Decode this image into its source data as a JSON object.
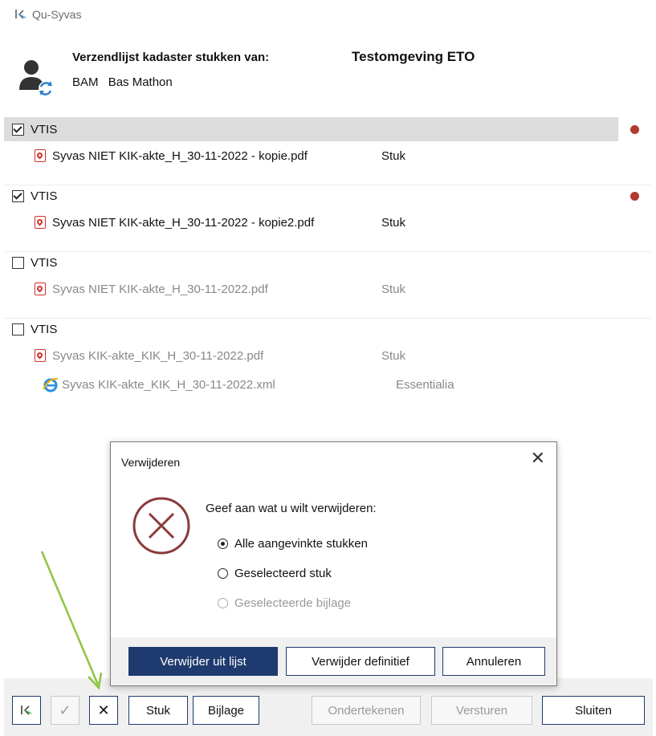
{
  "app": {
    "title": "Qu-Syvas"
  },
  "header": {
    "label": "Verzendlijst kadaster stukken van:",
    "environment": "Testomgeving ETO",
    "user_code": "BAM",
    "user_name": "Bas Mathon"
  },
  "groups": [
    {
      "label": "VTIS",
      "checked": true,
      "selected": true,
      "status_dot": true,
      "files": [
        {
          "name": "Syvas NIET KIK-akte_H_30-11-2022 - kopie.pdf",
          "type": "Stuk",
          "icon": "pdf-icon"
        }
      ]
    },
    {
      "label": "VTIS",
      "checked": true,
      "selected": false,
      "status_dot": true,
      "files": [
        {
          "name": "Syvas NIET KIK-akte_H_30-11-2022 - kopie2.pdf",
          "type": "Stuk",
          "icon": "pdf-icon"
        }
      ]
    },
    {
      "label": "VTIS",
      "checked": false,
      "selected": false,
      "status_dot": false,
      "files": [
        {
          "name": "Syvas NIET KIK-akte_H_30-11-2022.pdf",
          "type": "Stuk",
          "icon": "pdf-icon"
        }
      ]
    },
    {
      "label": "VTIS",
      "checked": false,
      "selected": false,
      "status_dot": false,
      "files": [
        {
          "name": "Syvas KIK-akte_KIK_H_30-11-2022.pdf",
          "type": "Stuk",
          "icon": "pdf-icon"
        },
        {
          "name": "Syvas KIK-akte_KIK_H_30-11-2022.xml",
          "type": "Essentialia",
          "icon": "ie-icon"
        }
      ]
    }
  ],
  "dialog": {
    "title": "Verwijderen",
    "close_label": "✕",
    "prompt": "Geef aan wat u wilt verwijderen:",
    "options": [
      {
        "label": "Alle aangevinkte stukken",
        "selected": true,
        "enabled": true
      },
      {
        "label": "Geselecteerd stuk",
        "selected": false,
        "enabled": true
      },
      {
        "label": "Geselecteerde bijlage",
        "selected": false,
        "enabled": false
      }
    ],
    "buttons": {
      "remove_from_list": "Verwijder uit lijst",
      "remove_permanent": "Verwijder definitief",
      "cancel": "Annuleren"
    }
  },
  "toolbar": {
    "check_label": "✓",
    "delete_label": "✕",
    "stuk_label": "Stuk",
    "bijlage_label": "Bijlage",
    "sign_label": "Ondertekenen",
    "send_label": "Versturen",
    "close_label": "Sluiten"
  },
  "colors": {
    "accent": "#1f3a6e",
    "status_dot": "#b03a2e",
    "error_icon": "#8b3a3a",
    "annotation_arrow": "#8dc63f"
  }
}
